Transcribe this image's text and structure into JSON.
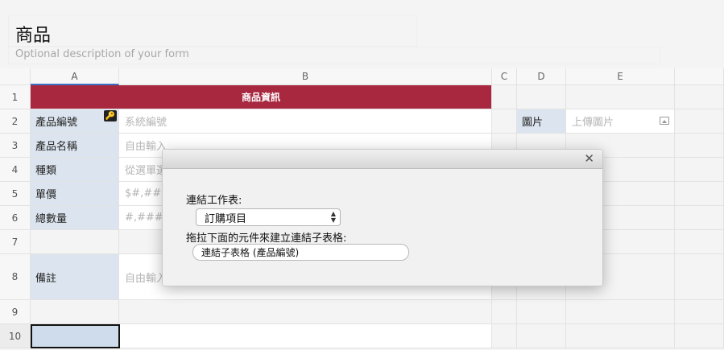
{
  "form": {
    "title": "商品",
    "description_placeholder": "Optional description of your form"
  },
  "grid": {
    "columns": [
      "A",
      "B",
      "C",
      "D",
      "E"
    ],
    "rows": [
      "1",
      "2",
      "3",
      "4",
      "5",
      "6",
      "7",
      "8",
      "9",
      "10"
    ],
    "banner": "商品資訊",
    "fields": [
      {
        "label": "產品編號",
        "placeholder": "系統編號"
      },
      {
        "label": "產品名稱",
        "placeholder": "自由輸入"
      },
      {
        "label": "種類",
        "placeholder": "從選單選"
      },
      {
        "label": "單價",
        "placeholder": "$#,###"
      },
      {
        "label": "總數量",
        "placeholder": "#,###"
      },
      {
        "label": "備註",
        "placeholder": "自由輸入"
      }
    ],
    "image_field": {
      "label": "圖片",
      "placeholder": "上傳圖片"
    }
  },
  "dialog": {
    "sheet_label": "連結工作表:",
    "sheet_selected": "訂購項目",
    "drag_instruction": "拖拉下面的元件來建立連結子表格:",
    "chip_label": "連結子表格 (產品編號)",
    "close_glyph": "✕"
  },
  "colors": {
    "banner": "#a82840",
    "label_bg": "#dce5ef",
    "selected_bg": "#cfdcec",
    "active_column_indicator": "#3c6fbf"
  }
}
